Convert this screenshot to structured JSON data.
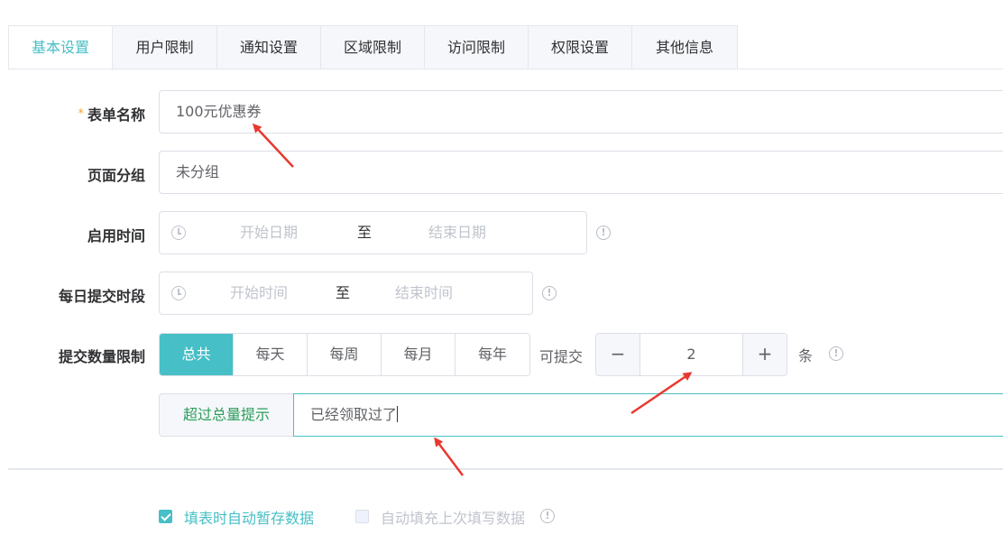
{
  "tabs": [
    "基本设置",
    "用户限制",
    "通知设置",
    "区域限制",
    "访问限制",
    "权限设置",
    "其他信息"
  ],
  "form": {
    "required_mark": "*",
    "name_label": "表单名称",
    "name_value": "100元优惠券",
    "group_label": "页面分组",
    "group_value": "未分组",
    "enable_time_label": "启用时间",
    "start_date_ph": "开始日期",
    "end_date_ph": "结束日期",
    "range_sep": "至",
    "daily_label": "每日提交时段",
    "start_time_ph": "开始时间",
    "end_time_ph": "结束时间",
    "limit_label": "提交数量限制",
    "limit_options": [
      "总共",
      "每天",
      "每周",
      "每月",
      "每年"
    ],
    "limit_selected": "总共",
    "can_submit_label": "可提交",
    "minus": "−",
    "plus": "+",
    "count_value": "2",
    "unit": "条",
    "over_prefix": "超过总量提示",
    "over_value": "已经领取过了"
  },
  "options": {
    "autosave_label": "填表时自动暂存数据",
    "autosave_checked": true,
    "autofill_label": "自动填充上次填写数据",
    "autofill_checked": false
  },
  "icons": {
    "info": "!",
    "clock": "clock-icon"
  },
  "colors": {
    "accent": "#47bfc6",
    "arrow": "#e8392f"
  }
}
